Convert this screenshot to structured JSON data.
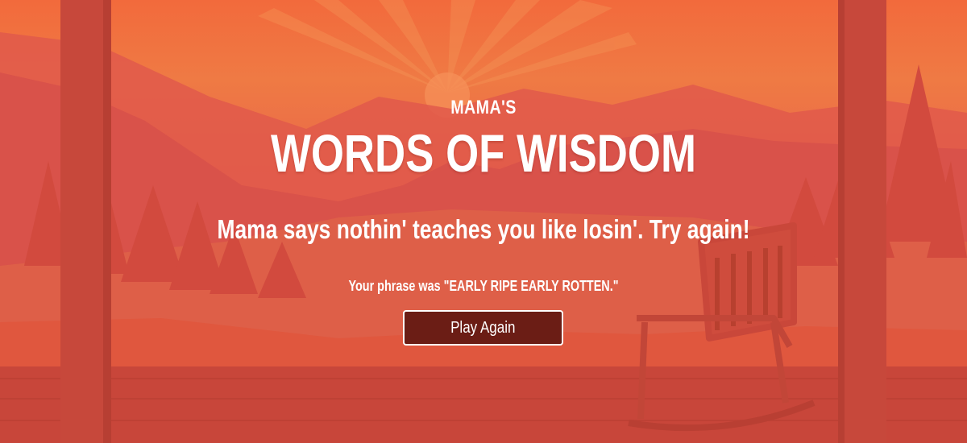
{
  "header": {
    "kicker": "MAMA'S",
    "title": "WORDS OF WISDOM"
  },
  "result": {
    "message": "Mama says nothin' teaches you like losin'. Try again!",
    "phrase_text": "Your phrase was \"EARLY RIPE EARLY ROTTEN.\""
  },
  "actions": {
    "play_again_label": "Play Again"
  },
  "colors": {
    "sky_top": "#f26a3c",
    "sky_mid": "#ef7a44",
    "mountain": "#d9534a",
    "porch": "#c9483a",
    "button_bg": "#6b1d15",
    "text": "#ffffff"
  }
}
